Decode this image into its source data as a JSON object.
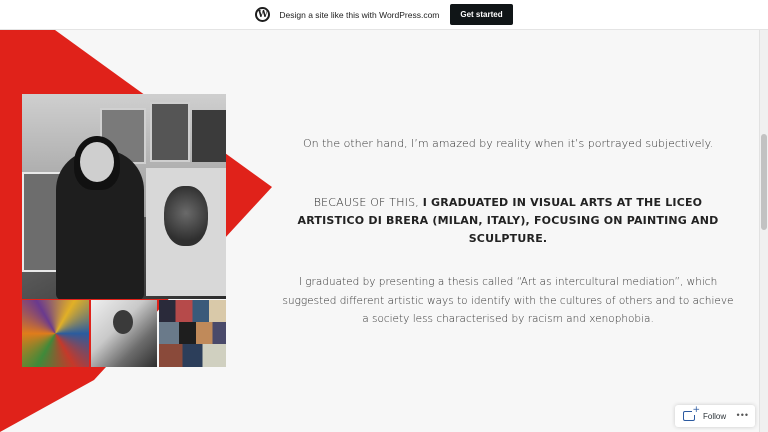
{
  "wp_bar": {
    "icon": "wordpress-logo-icon",
    "logo_letter": "W",
    "promo_text": "Design a site like this with WordPress.com",
    "cta_label": "Get started"
  },
  "colors": {
    "accent_red": "#e0221a",
    "background": "#f7f7f7",
    "cta_bg": "#101517"
  },
  "content": {
    "p1": "On the other hand, I’m amazed by reality when it’s portrayed subjectively.",
    "p2_lead": "BECAUSE OF THIS,",
    "p2_bold": "I GRADUATED IN VISUAL ARTS AT THE LICEO ARTISTICO DI BRERA (MILAN, ITALY), FOCUSING ON PAINTING AND SCULPTURE.",
    "p3": "I graduated by presenting a thesis called “Art as intercultural mediation”, which suggested different artistic ways to identify with the cultures of others and to achieve a society less characterised by racism and xenophobia."
  },
  "images": {
    "main": "artist-with-paintings-photo",
    "thumbs": [
      "colorful-paintings-collage",
      "artist-sculpting-photo",
      "exhibition-photo-collage"
    ]
  },
  "follow_widget": {
    "icon": "reader-follow-icon",
    "label": "Follow",
    "more": "•••"
  }
}
